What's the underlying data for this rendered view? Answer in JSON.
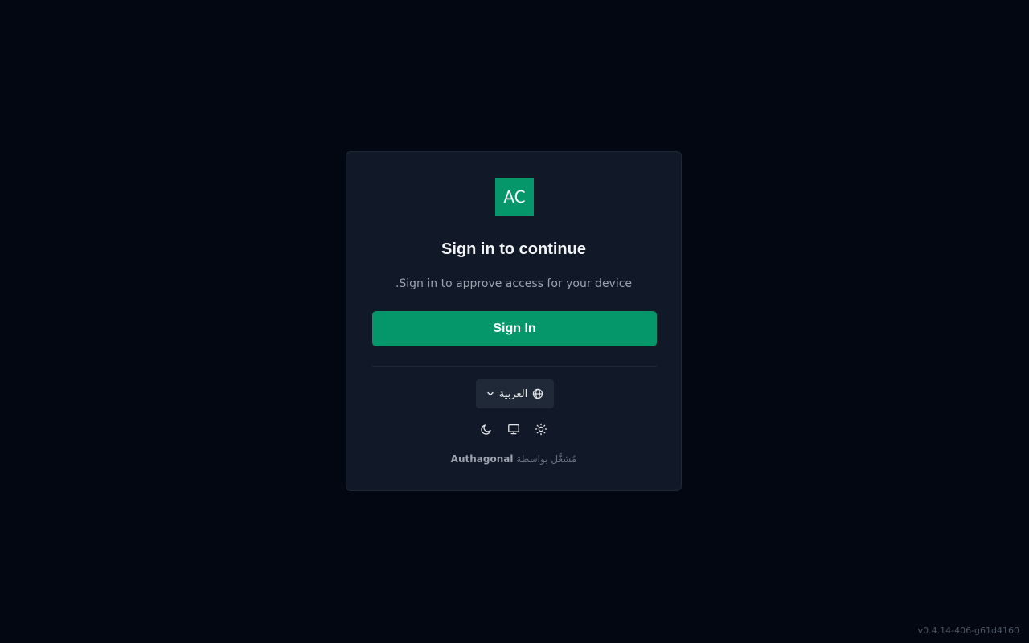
{
  "app": {
    "logo_text": "AC",
    "title": "Sign in to continue",
    "subtitle": ".Sign in to approve access for your device",
    "signin_label": "Sign In"
  },
  "language": {
    "selected": "العربية",
    "icon": "globe-icon",
    "dropdown_icon": "chevron-down-icon"
  },
  "theme_toggle": {
    "options": [
      {
        "name": "dark",
        "icon": "moon-icon"
      },
      {
        "name": "system",
        "icon": "monitor-icon"
      },
      {
        "name": "light",
        "icon": "sun-icon"
      }
    ]
  },
  "footer": {
    "powered_prefix": "مُشغَّل بواسطة",
    "brand": "Authagonal",
    "version": "v0.4.14-406-g61d4160"
  },
  "colors": {
    "background": "#030712",
    "card": "#111827",
    "accent": "#059669"
  }
}
